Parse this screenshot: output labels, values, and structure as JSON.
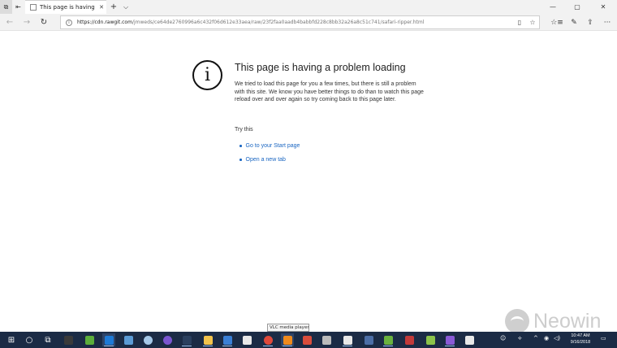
{
  "browser": {
    "tab": {
      "title": "This page is having a pr",
      "close_glyph": "✕"
    },
    "new_tab_glyph": "+",
    "tab_list_glyph": "⌵",
    "window_controls": {
      "minimize": "—",
      "maximize": "▢",
      "close": "✕"
    },
    "nav": {
      "back": "←",
      "forward": "→",
      "refresh": "↻"
    },
    "address": {
      "host": "https://cdn.rawgit.com",
      "path": "/jmweds/ce64de2760996a6c432f06d612e33aea/raw/23f2faa0aadb4babbfd228c8bb32a26a8c51c741/safari-ripper.html"
    },
    "address_actions": {
      "reading_view": "▯",
      "favorite": "☆"
    },
    "toolbar": {
      "favorites": "☆≡",
      "notes": "✎",
      "share": "⇪",
      "more": "···"
    }
  },
  "error": {
    "icon_glyph": "i",
    "title": "This page is having a problem loading",
    "body": "We tried to load this page for you a few times, but there is still a problem with this site. We know you have better things to do than to watch this page reload over and over again so try coming back to this page later.",
    "try_label": "Try this",
    "suggestions": [
      "Go to your Start page",
      "Open a new tab"
    ]
  },
  "tooltip": "VLC media player",
  "watermark": "Neowin",
  "taskbar": {
    "icons": [
      {
        "name": "start",
        "glyph": "⊞",
        "color": "#ffffff"
      },
      {
        "name": "search",
        "glyph": "○",
        "color": "#ffffff"
      },
      {
        "name": "task-view",
        "glyph": "⧉",
        "color": "#ffffff"
      },
      {
        "name": "app-1",
        "color": "#3a3a3a"
      },
      {
        "name": "app-2",
        "color": "#5cae3b"
      },
      {
        "name": "edge",
        "color": "#1e7ad6"
      },
      {
        "name": "app-3",
        "color": "#5b9bd5"
      },
      {
        "name": "app-4",
        "color": "#a5c8e8"
      },
      {
        "name": "app-5",
        "color": "#7a55d0"
      },
      {
        "name": "steam",
        "color": "#2a3f5e"
      },
      {
        "name": "file-explorer",
        "color": "#f2c34c"
      },
      {
        "name": "store",
        "color": "#3a7fd5"
      },
      {
        "name": "mail",
        "color": "#e8e8e8"
      },
      {
        "name": "chrome",
        "color": "#e0493b"
      },
      {
        "name": "vlc",
        "color": "#f08a1c"
      },
      {
        "name": "app-6",
        "color": "#d94d3c"
      },
      {
        "name": "app-7",
        "color": "#bbbbbb"
      },
      {
        "name": "calculator",
        "color": "#e8e8e8"
      },
      {
        "name": "app-8",
        "color": "#4c6ea6"
      },
      {
        "name": "app-9",
        "color": "#6ab23e"
      },
      {
        "name": "app-10",
        "color": "#c23a3a"
      },
      {
        "name": "app-11",
        "color": "#8bc34a"
      },
      {
        "name": "visual-studio",
        "color": "#8a5ad6"
      },
      {
        "name": "app-12",
        "color": "#e8e8e8"
      }
    ],
    "tray": {
      "people": "☺",
      "network": "⟡",
      "chevron": "^",
      "volume": "◁)",
      "notifications": "▭"
    },
    "time": "10:47 AM",
    "date": "9/16/2018"
  }
}
